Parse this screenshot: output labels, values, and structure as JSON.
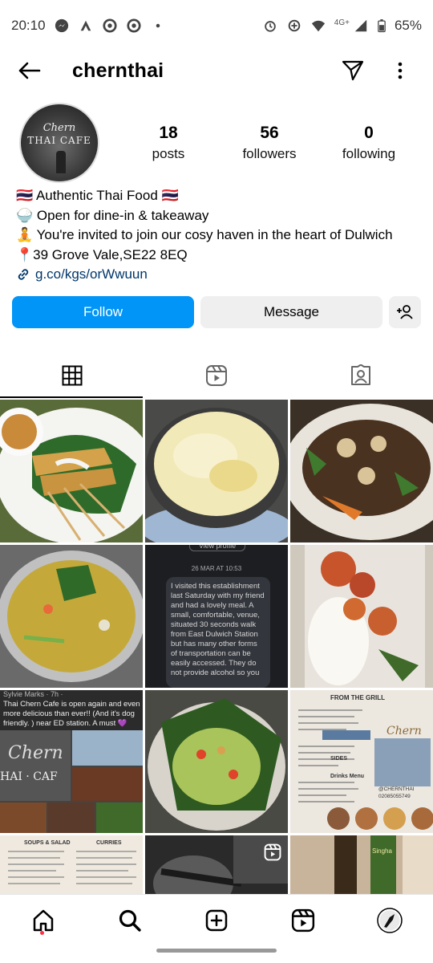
{
  "status_bar": {
    "time": "20:10",
    "network": "4G+",
    "battery": "65%"
  },
  "header": {
    "username": "chernthai"
  },
  "avatar": {
    "logo_line1": "Chern",
    "logo_line2": "THAI CAFE"
  },
  "stats": [
    {
      "value": "18",
      "label": "posts"
    },
    {
      "value": "56",
      "label": "followers"
    },
    {
      "value": "0",
      "label": "following"
    }
  ],
  "bio": {
    "line1": "🇹🇭 Authentic Thai Food 🇹🇭",
    "line2": "🍚 Open for dine-in & takeaway",
    "line3": "🧘 You're invited to join our cosy haven in the heart of Dulwich",
    "line4": "📍39 Grove Vale,SE22 8EQ",
    "link": "g.co/kgs/orWwuun"
  },
  "actions": {
    "follow_label": "Follow",
    "message_label": "Message"
  },
  "tabs": [
    "posts-grid",
    "reels",
    "tagged"
  ],
  "posts": {
    "review_date": "26 MAR AT 10:53",
    "review_header": "View profile",
    "review_text": "I visited this establishment last Saturday with my friend and had a lovely meal. A small, comfortable, venue, situated 30 seconds walk from East Dulwich Station but has many other forms of transportation can be easily accessed. They do not provide alcohol so you",
    "fb_author": "Sylvie Marks · 7h · ",
    "fb_text": "Thai Chern Cafe is open again and even more delicious than ever!! (And it's dog friendly. ) near ED station. A must 💜",
    "menu_grill_title": "FROM THE GRILL",
    "menu_soups_title": "SOUPS & SALAD",
    "menu_curries_title": "CURRIES",
    "menu_sides_title": "SIDES",
    "menu_drinks_title": "Drinks Menu",
    "menu_handle": "@CHERNTHAI",
    "menu_phone": "02085055749",
    "beer_label": "Singha"
  },
  "colors": {
    "accent": "#0095f6",
    "link": "#00376b",
    "button_secondary": "#efefef",
    "notification_dot": "#ff3040"
  }
}
